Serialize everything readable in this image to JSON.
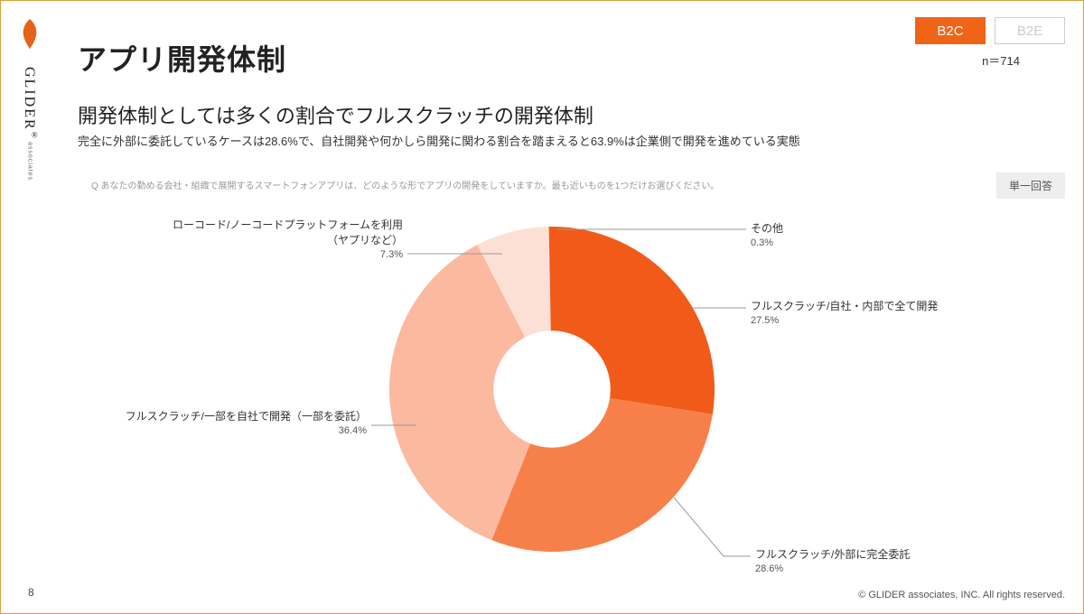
{
  "brand": {
    "name": "GLIDER",
    "sub": "associates",
    "reg": "®"
  },
  "header": {
    "title": "アプリ開発体制",
    "subtitle": "開発体制としては多くの割合でフルスクラッチの開発体制",
    "subdesc": "完全に外部に委託しているケースは28.6%で、自社開発や何かしら開発に関わる割合を踏まえると63.9%は企業側で開発を進めている実態",
    "question": "Q あなたの勤める会社・組織で展開するスマートフォンアプリは、どのような形でアプリの開発をしていますか。最も近いものを1つだけお選びください。"
  },
  "tags": {
    "active": "B2C",
    "inactive": "B2E"
  },
  "meta": {
    "n_label": "n＝714",
    "answer_type": "単一回答"
  },
  "footer": {
    "page": "8",
    "copyright": "© GLIDER associates, INC. All rights reserved."
  },
  "chart_data": {
    "type": "pie",
    "title": "アプリ開発体制",
    "series": [
      {
        "name": "フルスクラッチ/自社・内部で全て開発",
        "value": 27.5,
        "color": "#f25a1a"
      },
      {
        "name": "フルスクラッチ/外部に完全委託",
        "value": 28.6,
        "color": "#f7804a"
      },
      {
        "name": "フルスクラッチ/一部を自社で開発（一部を委託）",
        "value": 36.4,
        "color": "#fbb9a0"
      },
      {
        "name": "ローコード/ノーコードプラットフォームを利用（ヤプリなど）",
        "value": 7.3,
        "color": "#fde0d5"
      },
      {
        "name": "その他",
        "value": 0.3,
        "color": "#f25a1a"
      }
    ],
    "donut_inner_ratio": 0.36
  },
  "callouts": {
    "c0": {
      "name": "フルスクラッチ/自社・内部で全て開発",
      "pct": "27.5%"
    },
    "c1": {
      "name": "フルスクラッチ/外部に完全委託",
      "pct": "28.6%"
    },
    "c2": {
      "name": "フルスクラッチ/一部を自社で開発（一部を委託）",
      "pct": "36.4%"
    },
    "c3a": {
      "name": "ローコード/ノーコードプラットフォームを利用"
    },
    "c3b": {
      "name": "（ヤプリなど）",
      "pct": "7.3%"
    },
    "c4": {
      "name": "その他",
      "pct": "0.3%"
    }
  }
}
